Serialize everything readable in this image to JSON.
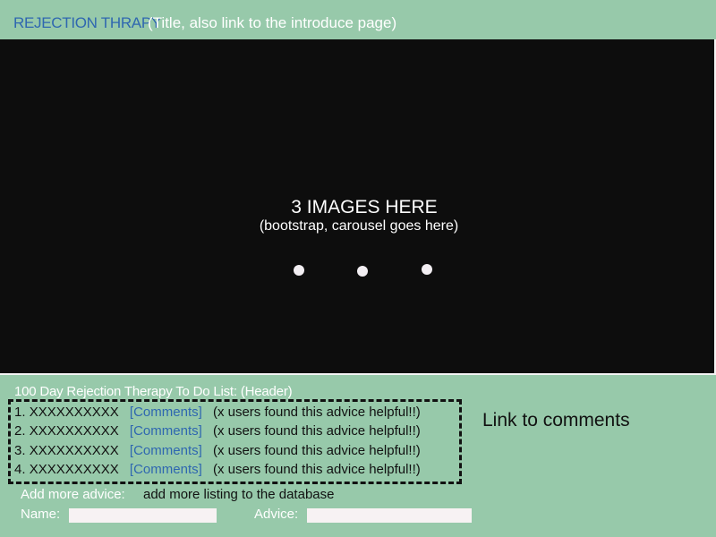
{
  "header": {
    "title": "REJECTION THRAPY",
    "title_note": "(Title, also link to the introduce page)"
  },
  "carousel": {
    "title": "3  IMAGES HERE",
    "subtitle": "(bootstrap, carousel goes here)",
    "indicator_count": 3
  },
  "todo": {
    "header": "100 Day Rejection Therapy To Do List: (Header)",
    "items": [
      {
        "number": "1.",
        "text": "XXXXXXXXXX",
        "comments_label": "[Comments]",
        "helpful": "(x users found this advice helpful!!)"
      },
      {
        "number": "2.",
        "text": "XXXXXXXXXX",
        "comments_label": "[Comments]",
        "helpful": "(x users found this advice helpful!!)"
      },
      {
        "number": "3.",
        "text": "XXXXXXXXXX",
        "comments_label": "[Comments]",
        "helpful": "(x users found this advice helpful!!)"
      },
      {
        "number": "4.",
        "text": "XXXXXXXXXX",
        "comments_label": "[Comments]",
        "helpful": "(x users found this advice helpful!!)"
      }
    ],
    "side_note": "Link to comments"
  },
  "add_form": {
    "label": "Add more advice:",
    "description": "add more listing to the database",
    "name_label": "Name:",
    "name_value": "",
    "advice_label": "Advice:",
    "advice_value": ""
  },
  "colors": {
    "background": "#97c9aa",
    "carousel": "#0d0d0d",
    "link": "#2f67b0"
  }
}
